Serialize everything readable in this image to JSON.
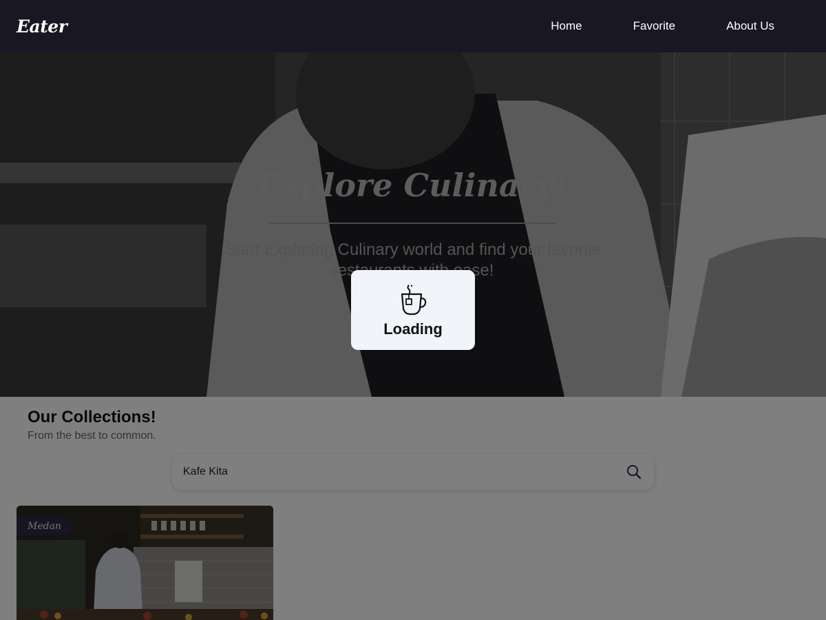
{
  "header": {
    "logo": "Eater",
    "nav": [
      {
        "label": "Home"
      },
      {
        "label": "Favorite"
      },
      {
        "label": "About Us"
      }
    ]
  },
  "hero": {
    "title": "Explore Culinary!",
    "subtitle": "Start Exploring Culinary world and find your favorite restaurants with ease!"
  },
  "collections": {
    "title": "Our Collections!",
    "subtitle": "From the best to common.",
    "search": {
      "value": "Kafe Kita",
      "icon": "search-icon"
    },
    "cards": [
      {
        "city": "Medan"
      }
    ]
  },
  "loading": {
    "label": "Loading",
    "icon": "teacup-icon"
  },
  "colors": {
    "navbar": "#1a1725",
    "badge": "#2d2a44",
    "modal": "#f1f4f8"
  }
}
